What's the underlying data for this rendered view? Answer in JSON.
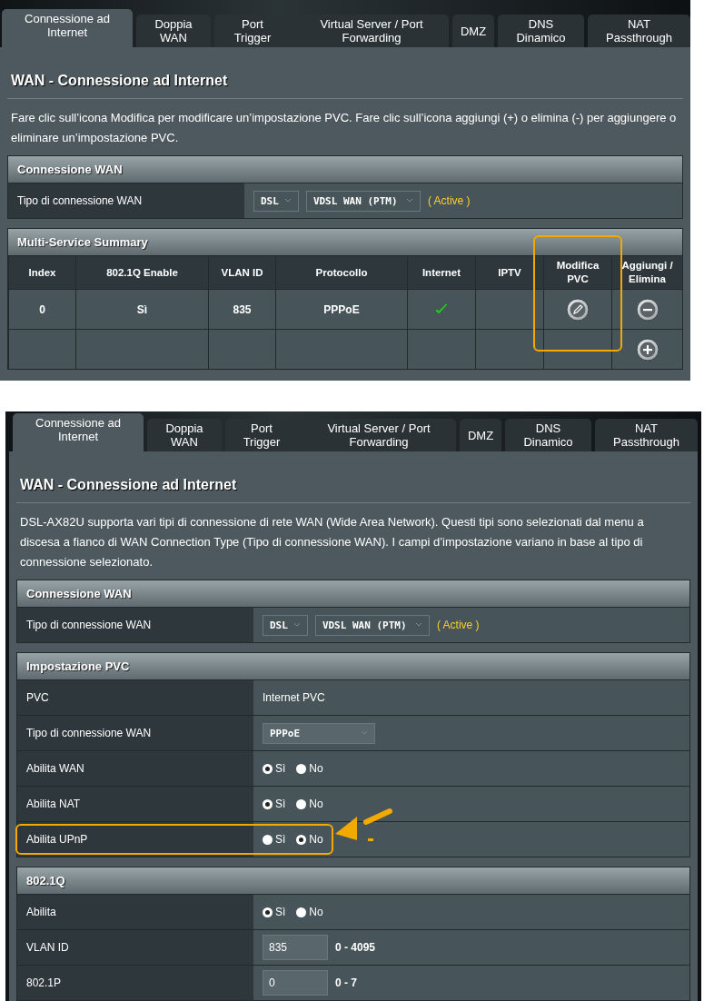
{
  "panels": [
    {
      "tabs": [
        {
          "label": "Connessione ad Internet",
          "selected": true
        },
        {
          "label": "Doppia WAN",
          "selected": false
        },
        {
          "label": "Port Trigger",
          "selected": false
        },
        {
          "label": "Virtual Server / Port Forwarding",
          "selected": false
        },
        {
          "label": "DMZ",
          "selected": false
        },
        {
          "label": "DNS Dinamico",
          "selected": false
        },
        {
          "label": "NAT Passthrough",
          "selected": false
        }
      ],
      "title": "WAN - Connessione ad Internet",
      "description": "Fare clic sull’icona Modifica per modificare un’impostazione PVC. Fare clic sull’icona aggiungi (+) o elimina (-) per aggiungere o eliminare un’impostazione PVC.",
      "sections": [
        {
          "kind": "wan",
          "header": "Connessione WAN",
          "label": "Tipo di connessione WAN",
          "dsl": "DSL",
          "type": "VDSL WAN (PTM)",
          "status": "( Active )"
        },
        {
          "kind": "summary",
          "header": "Multi-Service Summary",
          "columns": [
            {
              "label": "Index",
              "highlighted": false
            },
            {
              "label": "802.1Q Enable",
              "highlighted": false
            },
            {
              "label": "VLAN ID",
              "highlighted": false
            },
            {
              "label": "Protocollo",
              "highlighted": false
            },
            {
              "label": "Internet",
              "highlighted": false
            },
            {
              "label": "IPTV",
              "highlighted": false
            },
            {
              "label": "Modifica PVC",
              "highlighted": true
            },
            {
              "label": "Aggiungi / Elimina",
              "highlighted": false
            }
          ],
          "rows": [
            {
              "kind": "entry",
              "index": "0",
              "enable": "Sì",
              "vlan": "835",
              "protocol": "PPPoE",
              "internet": true
            },
            {
              "kind": "add"
            }
          ]
        }
      ]
    },
    {
      "tabs": [
        {
          "label": "Connessione ad Internet",
          "selected": true
        },
        {
          "label": "Doppia WAN",
          "selected": false
        },
        {
          "label": "Port Trigger",
          "selected": false
        },
        {
          "label": "Virtual Server / Port Forwarding",
          "selected": false
        },
        {
          "label": "DMZ",
          "selected": false
        },
        {
          "label": "DNS Dinamico",
          "selected": false
        },
        {
          "label": "NAT Passthrough",
          "selected": false
        }
      ],
      "title": "WAN - Connessione ad Internet",
      "description": "DSL-AX82U supporta vari tipi di connessione di rete WAN (Wide Area Network). Questi tipi sono selezionati dal menu a discesa a fianco di WAN Connection Type (Tipo di connessione WAN). I campi d’impostazione variano in base al tipo di connessione selezionato.",
      "sections": [
        {
          "kind": "wan",
          "header": "Connessione WAN",
          "label": "Tipo di connessione WAN",
          "dsl": "DSL",
          "type": "VDSL WAN (PTM)",
          "status": "( Active )"
        },
        {
          "kind": "form",
          "header": "Impostazione PVC",
          "rows": [
            {
              "kind": "text",
              "label": "PVC",
              "value": "Internet PVC",
              "highlighted": false
            },
            {
              "kind": "select",
              "label": "Tipo di connessione WAN",
              "value": "PPPoE",
              "highlighted": false
            },
            {
              "kind": "radio",
              "label": "Abilita WAN",
              "options": [
                {
                  "label": "Sì",
                  "selected": true
                },
                {
                  "label": "No",
                  "selected": false
                }
              ],
              "highlighted": false
            },
            {
              "kind": "radio",
              "label": "Abilita NAT",
              "options": [
                {
                  "label": "Sì",
                  "selected": true
                },
                {
                  "label": "No",
                  "selected": false
                }
              ],
              "highlighted": false
            },
            {
              "kind": "radio",
              "label": "Abilita UPnP",
              "options": [
                {
                  "label": "Sì",
                  "selected": false
                },
                {
                  "label": "No",
                  "selected": true
                }
              ],
              "highlighted": true
            }
          ]
        },
        {
          "kind": "form",
          "header": "802.1Q",
          "rows": [
            {
              "kind": "radio",
              "label": "Abilita",
              "options": [
                {
                  "label": "Sì",
                  "selected": true
                },
                {
                  "label": "No",
                  "selected": false
                }
              ],
              "highlighted": false
            },
            {
              "kind": "input",
              "label": "VLAN ID",
              "value": "835",
              "range": "0 - 4095",
              "highlighted": false
            },
            {
              "kind": "input",
              "label": "802.1P",
              "value": "0",
              "range": "0 - 7",
              "highlighted": false
            }
          ]
        }
      ]
    }
  ]
}
